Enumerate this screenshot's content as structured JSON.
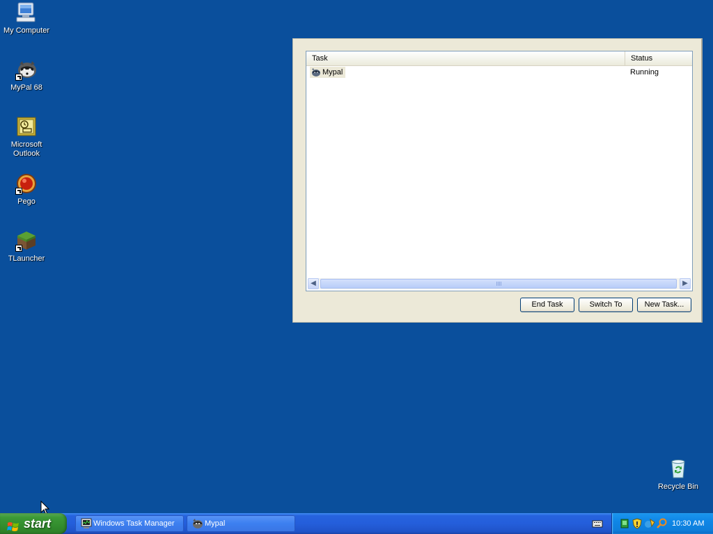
{
  "desktop": {
    "icons": [
      {
        "label": "My Computer",
        "icon": "my-computer-icon"
      },
      {
        "label": "MyPal 68",
        "icon": "mypal-icon"
      },
      {
        "label": "Microsoft Outlook",
        "icon": "outlook-icon"
      },
      {
        "label": "Pego",
        "icon": "pego-icon"
      },
      {
        "label": "TLauncher",
        "icon": "tlauncher-icon"
      },
      {
        "label": "Recycle Bin",
        "icon": "recycle-bin-icon"
      }
    ]
  },
  "task_manager": {
    "columns": {
      "task": "Task",
      "status": "Status"
    },
    "rows": [
      {
        "task": "Mypal",
        "status": "Running",
        "icon": "mypal-icon"
      }
    ],
    "buttons": {
      "end_task": "End Task",
      "switch_to": "Switch To",
      "new_task": "New Task..."
    }
  },
  "taskbar": {
    "start_label": "start",
    "tasks": [
      {
        "label": "Windows Task Manager",
        "icon": "task-manager-icon"
      },
      {
        "label": "Mypal",
        "icon": "mypal-icon"
      }
    ],
    "clock": "10:30 AM",
    "tray_icons": [
      "network-icon",
      "security-shield-icon",
      "update-icon",
      "search-icon"
    ]
  },
  "colors": {
    "desktop": "#0a4f9c",
    "taskbar": "#245edb",
    "start": "#3c9a36",
    "tray": "#0f86e6",
    "window": "#ece9d8"
  }
}
